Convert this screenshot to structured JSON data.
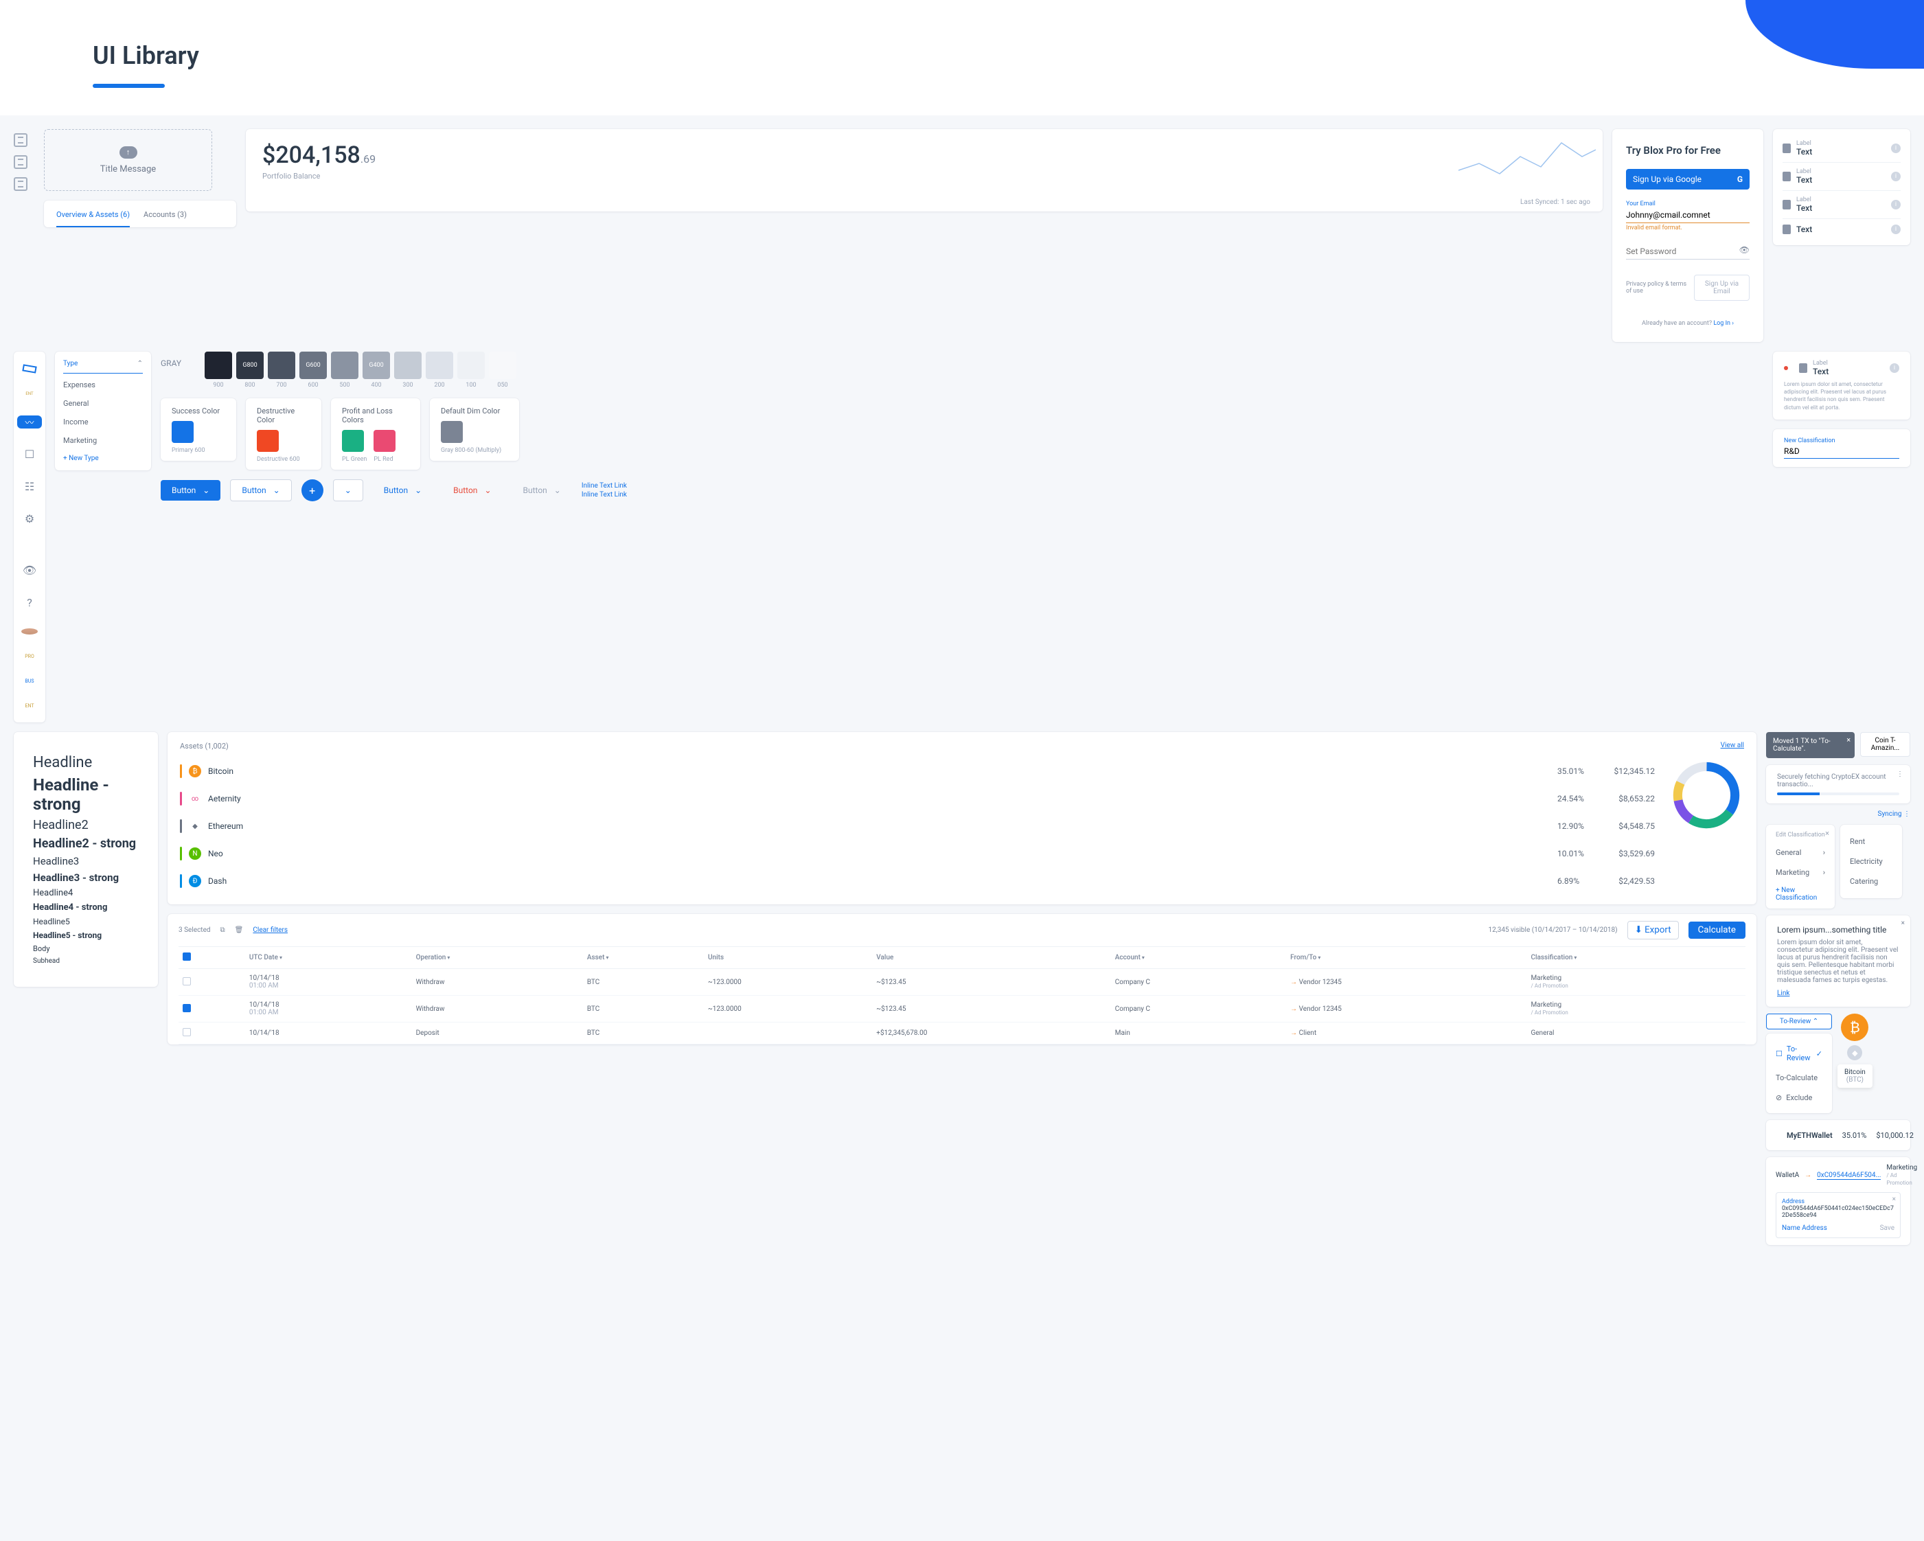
{
  "page": {
    "title": "UI Library"
  },
  "upload": {
    "title": "Title Message"
  },
  "balance": {
    "value_main": "$204,158",
    "value_dec": ".69",
    "label": "Portfolio Balance",
    "sync": "Last Synced: 1 sec ago"
  },
  "tabs": {
    "a": "Overview & Assets (6)",
    "b": "Accounts (3)"
  },
  "signup": {
    "title": "Try Blox Pro for Free",
    "google": "Sign Up via Google",
    "email_label": "Your Email",
    "email_value": "Johnny@cmail.comnet",
    "email_error": "Invalid email format.",
    "pwd_placeholder": "Set Password",
    "policy": "Privacy policy & terms of use",
    "email_btn": "Sign Up via Email",
    "have": "Already have an account?",
    "login": "Log In"
  },
  "label_rows": [
    {
      "lbl": "Label",
      "txt": "Text"
    },
    {
      "lbl": "Label",
      "txt": "Text"
    },
    {
      "lbl": "Label",
      "txt": "Text"
    },
    {
      "lbl": "",
      "txt": "Text"
    }
  ],
  "helper": {
    "lbl": "Label",
    "txt": "Text",
    "note": "Lorem ipsum dolor sit amet, consectetur adipiscing elit. Praesent vel lacus at purus hendrerit facilisis non quis sem. Praesent dictum vel elit at porta."
  },
  "classification_input": {
    "lbl": "New Classification",
    "val": "R&D"
  },
  "sidebar_pills": {
    "a": "ENT",
    "b": "PRO",
    "c": "BUS",
    "d": "ENT"
  },
  "type_menu": {
    "header": "Type",
    "items": [
      "Expenses",
      "General",
      "Income",
      "Marketing"
    ],
    "new": "+ New Type"
  },
  "palette": {
    "label": "GRAY",
    "gray": [
      {
        "name": "900",
        "hex": "#1f2430",
        "tag": ""
      },
      {
        "name": "800",
        "hex": "#2f3744",
        "tag": "G800"
      },
      {
        "name": "700",
        "hex": "#4a5362",
        "tag": ""
      },
      {
        "name": "600",
        "hex": "#6b7483",
        "tag": "G600"
      },
      {
        "name": "500",
        "hex": "#8a93a2",
        "tag": ""
      },
      {
        "name": "400",
        "hex": "#a6aebb",
        "tag": "G400"
      },
      {
        "name": "300",
        "hex": "#c4cbd5",
        "tag": ""
      },
      {
        "name": "200",
        "hex": "#dde2ea",
        "tag": ""
      },
      {
        "name": "100",
        "hex": "#eef1f5",
        "tag": ""
      },
      {
        "name": "050",
        "hex": "#f7f8fa",
        "tag": ""
      }
    ],
    "cards": {
      "success": {
        "label": "Success Color",
        "chip": "#1473e6",
        "sub": "Primary 600"
      },
      "destructive": {
        "label": "Destructive Color",
        "chip": "#f04823",
        "sub": "Destructive 600"
      },
      "pl": {
        "label": "Profit and Loss Colors",
        "green": "#1ab083",
        "red": "#ea4a72",
        "g_lbl": "PL Green",
        "r_lbl": "PL Red"
      },
      "dim": {
        "label": "Default Dim Color",
        "chip": "#7b8494",
        "sub": "Gray 800-60 (Multiply)"
      }
    }
  },
  "buttons": {
    "b": "Button",
    "link": "Inline Text Link"
  },
  "typo": {
    "h1": "Headline",
    "h1s": "Headline - strong",
    "h2": "Headline2",
    "h2s": "Headline2 - strong",
    "h3": "Headline3",
    "h3s": "Headline3 - strong",
    "h4": "Headline4",
    "h4s": "Headline4 - strong",
    "h5": "Headline5",
    "h5s": "Headline5 - strong",
    "body": "Body",
    "sub": "Subhead"
  },
  "assets": {
    "title": "Assets (1,002)",
    "viewall": "View all",
    "rows": [
      {
        "color": "#f7931a",
        "ic_bg": "#f7931a",
        "ic": "₿",
        "name": "Bitcoin",
        "pct": "35.01%",
        "val": "$12,345.12"
      },
      {
        "color": "#e74a8a",
        "ic_bg": "#ffffff",
        "ic": "∞",
        "name": "Aeternity",
        "pct": "24.54%",
        "val": "$8,653.22"
      },
      {
        "color": "#6b7483",
        "ic_bg": "#ffffff",
        "ic": "◆",
        "name": "Ethereum",
        "pct": "12.90%",
        "val": "$4,548.75"
      },
      {
        "color": "#58bf00",
        "ic_bg": "#58bf00",
        "ic": "N",
        "name": "Neo",
        "pct": "10.01%",
        "val": "$3,529.69"
      },
      {
        "color": "#008de4",
        "ic_bg": "#008de4",
        "ic": "Đ",
        "name": "Dash",
        "pct": "6.89%",
        "val": "$2,429.53"
      }
    ]
  },
  "toast": {
    "text": "Moved 1 TX to \"To-Calculate\"."
  },
  "chip": {
    "text": "Coin T-Amazin..."
  },
  "progress": {
    "text": "Securely fetching CryptoEX account transactio..."
  },
  "syncing": "Syncing",
  "edit_class": {
    "title": "Edit Classification",
    "left": [
      "General",
      "Marketing"
    ],
    "new": "+ New Classification",
    "right": [
      "Rent",
      "Electricity",
      "Catering"
    ]
  },
  "notice": {
    "title": "Lorem ipsum...something title",
    "body": "Lorem ipsum dolor sit amet, consectetur adipiscing elit. Praesent vel lacus at purus hendrerit facilisis non quis sem. Pellentesque habitant morbi tristique senectus et netus et malesuada fames ac turpis egestas.",
    "link": "Link"
  },
  "review": {
    "pill": "To-Review",
    "items": [
      "To-Review",
      "To-Calculate",
      "Exclude"
    ]
  },
  "coin_tip": {
    "name": "Bitcoin",
    "sym": "(BTC)"
  },
  "wallet": {
    "name": "MyETHWallet",
    "pct": "35.01%",
    "val": "$10,000.12"
  },
  "table": {
    "selected": "3 Selected",
    "clear": "Clear filters",
    "visible": "12,345 visible (10/14/2017 – 10/14/2018)",
    "export": "Export",
    "calc": "Calculate",
    "headers": [
      "UTC Date",
      "Operation",
      "Asset",
      "Units",
      "Value",
      "Account",
      "From/To",
      "Classification"
    ],
    "rows": [
      {
        "chk": false,
        "date1": "10/14/'18",
        "date2": "01:00 AM",
        "op": "Withdraw",
        "asset": "BTC",
        "units": "~123.0000",
        "value": "~$123.45",
        "value_neg": true,
        "acct": "Company C",
        "to": "Vendor 12345",
        "cls": "Marketing",
        "cls2": "/ Ad Promotion"
      },
      {
        "chk": true,
        "date1": "10/14/'18",
        "date2": "01:00 AM",
        "op": "Withdraw",
        "asset": "BTC",
        "units": "~123.0000",
        "value": "~$123.45",
        "value_neg": true,
        "acct": "Company C",
        "to": "Vendor 12345",
        "cls": "Marketing",
        "cls2": "/ Ad Promotion"
      },
      {
        "chk": false,
        "date1": "10/14/'18",
        "date2": "",
        "op": "Deposit",
        "asset": "BTC",
        "units": "",
        "value": "+$12,345,678.00",
        "value_neg": false,
        "acct": "Main",
        "to": "Client",
        "cls": "General",
        "cls2": ""
      }
    ]
  },
  "transfer": {
    "from": "WalletA",
    "to": "0xC09544dA6F504...",
    "cls": "Marketing",
    "cls2": "/ Ad Promotion",
    "addr_lbl": "Address",
    "addr": "0xC09544dA6F50441c024ec150eCEDc72De558ce94",
    "name_addr": "Name Address",
    "save": "Save"
  },
  "chart_data": {
    "type": "pie",
    "title": "Assets (1,002)",
    "series": [
      {
        "name": "Bitcoin",
        "value": 35.01,
        "color": "#1473e6"
      },
      {
        "name": "Aeternity",
        "value": 24.54,
        "color": "#1ab083"
      },
      {
        "name": "Ethereum",
        "value": 12.9,
        "color": "#7b52e6"
      },
      {
        "name": "Neo",
        "value": 10.01,
        "color": "#f2c94c"
      },
      {
        "name": "Dash",
        "value": 6.89,
        "color": "#1473e6"
      },
      {
        "name": "Other",
        "value": 10.65,
        "color": "#e2e7ef"
      }
    ]
  }
}
